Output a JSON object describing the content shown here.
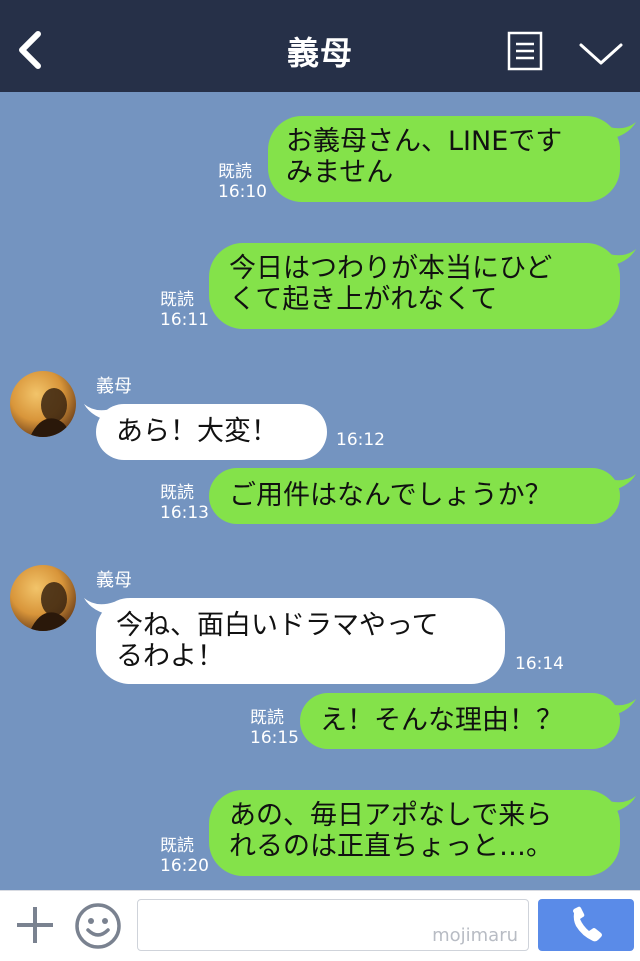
{
  "header": {
    "title": "義母"
  },
  "messages": [
    {
      "side": "right",
      "text_line1": "お義母さん、LINEです",
      "text_line2": "みません",
      "read": "既読",
      "time": "16:10"
    },
    {
      "side": "right",
      "text_line1": "今日はつわりが本当にひど",
      "text_line2": "くて起き上がれなくて",
      "read": "既読",
      "time": "16:11"
    },
    {
      "side": "left",
      "sender": "義母",
      "text_line1": "あら！大変！",
      "time": "16:12"
    },
    {
      "side": "right",
      "text_line1": "ご用件はなんでしょうか？",
      "read": "既読",
      "time": "16:13"
    },
    {
      "side": "left",
      "sender": "義母",
      "text_line1": "今ね、面白いドラマやって",
      "text_line2": "るわよ！",
      "time": "16:14"
    },
    {
      "side": "right",
      "text_line1": "え！そんな理由！？",
      "read": "既読",
      "time": "16:15"
    },
    {
      "side": "right",
      "text_line1": "あの、毎日アポなしで来ら",
      "text_line2": "れるのは正直ちょっと…。",
      "read": "既読",
      "time": "16:20"
    }
  ],
  "footer": {
    "input_value": "",
    "watermark": "mojimaru"
  },
  "colors": {
    "header_bg": "#263048",
    "chat_bg": "#7494c0",
    "my_bubble": "#84e24a",
    "their_bubble": "#ffffff",
    "call_button": "#5a8be8"
  },
  "icons": {
    "back": "chevron-left-icon",
    "menu": "list-icon",
    "collapse": "chevron-down-icon",
    "plus": "plus-icon",
    "emoji": "smiley-icon",
    "call": "phone-icon"
  }
}
